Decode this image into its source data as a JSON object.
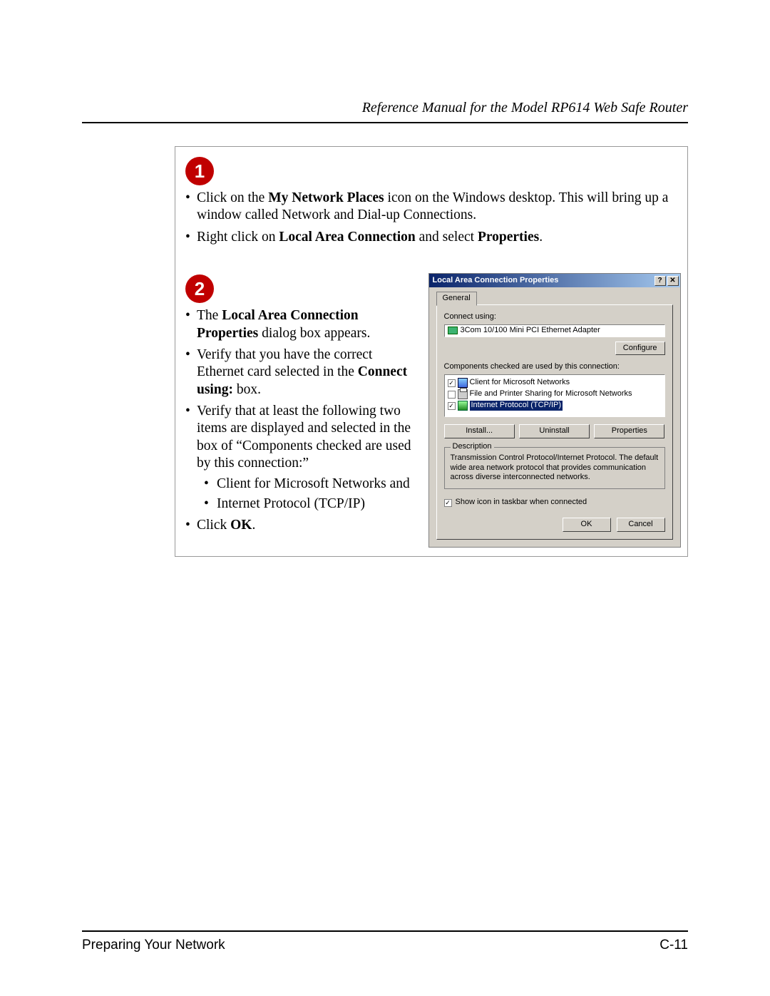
{
  "header": {
    "title": "Reference Manual for the Model RP614 Web Safe Router"
  },
  "step1": {
    "num": "1",
    "b1_pre": "Click on the ",
    "b1_bold": "My Network Places",
    "b1_post": " icon on the Windows desktop.  This will bring up a window called Network and Dial-up Connections.",
    "b2_pre": "Right click on ",
    "b2_bold1": "Local Area Connection",
    "b2_mid": " and select ",
    "b2_bold2": "Properties",
    "b2_end": "."
  },
  "step2": {
    "num": "2",
    "b1_pre": "The ",
    "b1_bold": "Local Area Connection Properties",
    "b1_post": " dialog box appears.",
    "b2_pre": "Verify that you have the correct Ethernet card selected in the ",
    "b2_bold": "Connect using:",
    "b2_post": " box.",
    "b3": "Verify that at least the following two items are displayed and selected in the box of “Components checked are used by this connection:”",
    "sub1": "Client for Microsoft Networks and",
    "sub2": "Internet Protocol (TCP/IP)",
    "b4_pre": "Click ",
    "b4_bold": "OK",
    "b4_post": "."
  },
  "dlg": {
    "title": "Local Area Connection Properties",
    "help": "?",
    "close": "✕",
    "tab": "General",
    "connect_label": "Connect using:",
    "adapter": "3Com 10/100 Mini PCI Ethernet Adapter",
    "configure": "Configure",
    "components_label": "Components checked are used by this connection:",
    "items": {
      "client": "Client for Microsoft Networks",
      "fps": "File and Printer Sharing for Microsoft Networks",
      "tcpip": "Internet Protocol (TCP/IP)"
    },
    "install": "Install...",
    "uninstall": "Uninstall",
    "properties": "Properties",
    "desc_title": "Description",
    "desc_text": "Transmission Control Protocol/Internet Protocol. The default wide area network protocol that provides communication across diverse interconnected networks.",
    "show_icon": "Show icon in taskbar when connected",
    "ok": "OK",
    "cancel": "Cancel"
  },
  "footer": {
    "left": "Preparing Your Network",
    "right": "C-11"
  }
}
